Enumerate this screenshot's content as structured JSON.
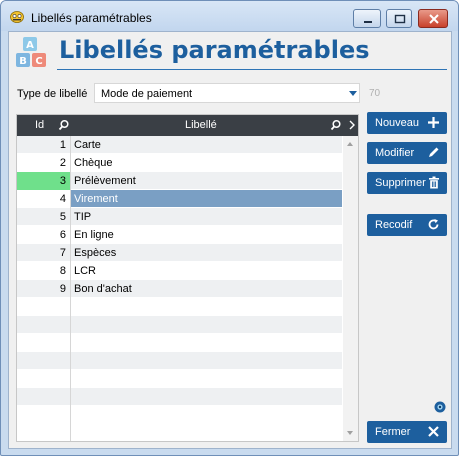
{
  "window": {
    "title": "Libellés paramétrables"
  },
  "header": {
    "title": "Libellés paramétrables"
  },
  "type_field": {
    "label": "Type de libellé",
    "value": "Mode de paiement",
    "count": "70"
  },
  "grid": {
    "columns": {
      "id": "Id",
      "libelle": "Libellé"
    },
    "rows": [
      {
        "id": "1",
        "libelle": "Carte"
      },
      {
        "id": "2",
        "libelle": "Chèque"
      },
      {
        "id": "3",
        "libelle": "Prélèvement"
      },
      {
        "id": "4",
        "libelle": "Virement"
      },
      {
        "id": "5",
        "libelle": "TIP"
      },
      {
        "id": "6",
        "libelle": "En ligne"
      },
      {
        "id": "7",
        "libelle": "Espèces"
      },
      {
        "id": "8",
        "libelle": "LCR"
      },
      {
        "id": "9",
        "libelle": "Bon d'achat"
      }
    ]
  },
  "buttons": {
    "new": "Nouveau",
    "modify": "Modifier",
    "delete": "Supprimer",
    "recode": "Recodif",
    "close": "Fermer"
  },
  "icons": {
    "app": "app-icon",
    "logo": "abc-blocks-icon",
    "search": "search-icon",
    "more": "chevron-right-icon",
    "new": "plus-icon",
    "modify": "pencil-icon",
    "delete": "trash-icon",
    "recode": "refresh-icon",
    "close": "close-x-icon",
    "eye": "eye-icon"
  },
  "colors": {
    "accent": "#1d5f9e",
    "header": "#3a3f45",
    "selected_row": "#7a9fc4",
    "current_marker": "#6fe08b"
  }
}
